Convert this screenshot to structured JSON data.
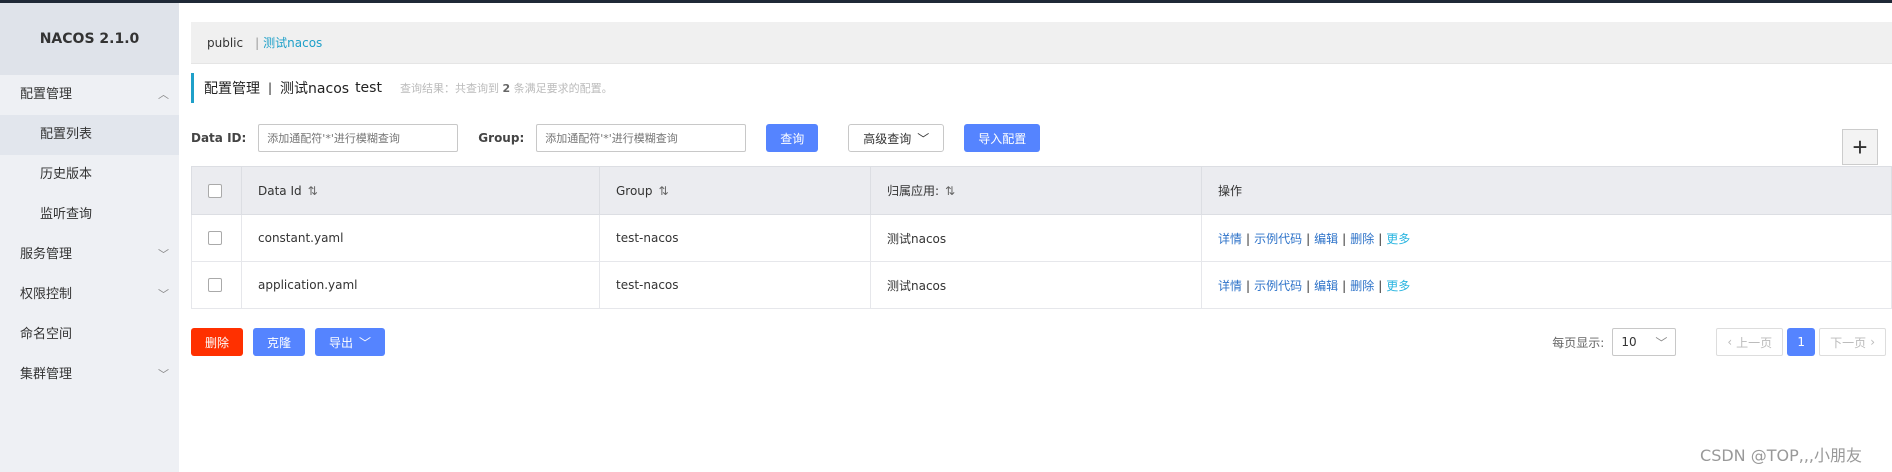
{
  "app": {
    "logo": "NACOS 2.1.0"
  },
  "sidebar": {
    "items": [
      {
        "label": "配置管理",
        "chevron": "^"
      },
      {
        "label": "配置列表"
      },
      {
        "label": "历史版本"
      },
      {
        "label": "监听查询"
      },
      {
        "label": "服务管理",
        "chevron": "v"
      },
      {
        "label": "权限控制",
        "chevron": "v"
      },
      {
        "label": "命名空间"
      },
      {
        "label": "集群管理",
        "chevron": "v"
      }
    ]
  },
  "namespaces": {
    "public": "public",
    "sep": "|",
    "active": "测试nacos"
  },
  "title": {
    "main": "配置管理",
    "sep": "|",
    "ns_name": "测试nacos",
    "ns_id": "test",
    "result_prefix": "查询结果：共查询到",
    "result_count": "2",
    "result_suffix": "条满足要求的配置。"
  },
  "filters": {
    "data_id_label": "Data ID:",
    "data_id_placeholder": "添加通配符'*'进行模糊查询",
    "group_label": "Group:",
    "group_placeholder": "添加通配符'*'进行模糊查询",
    "query_btn": "查询",
    "advanced_btn": "高级查询",
    "import_btn": "导入配置",
    "add_btn": "+"
  },
  "table": {
    "headers": {
      "data_id": "Data Id",
      "group": "Group",
      "app": "归属应用:",
      "ops": "操作"
    },
    "rows": [
      {
        "data_id": "constant.yaml",
        "group": "test-nacos",
        "app": "测试nacos"
      },
      {
        "data_id": "application.yaml",
        "group": "test-nacos",
        "app": "测试nacos"
      }
    ],
    "ops": {
      "detail": "详情",
      "sample": "示例代码",
      "edit": "编辑",
      "delete": "删除",
      "more": "更多",
      "sep": "|"
    }
  },
  "bottom": {
    "delete_btn": "删除",
    "clone_btn": "克隆",
    "export_btn": "导出"
  },
  "pager": {
    "label": "每页显示:",
    "size": "10",
    "prev": "上一页",
    "current": "1",
    "next": "下一页"
  },
  "watermark": "CSDN @TOP,,,小朋友",
  "colors": {
    "accent": "#1fa0c9",
    "primary": "#5584ff",
    "danger": "#ff3000",
    "link": "#2e73c9"
  }
}
